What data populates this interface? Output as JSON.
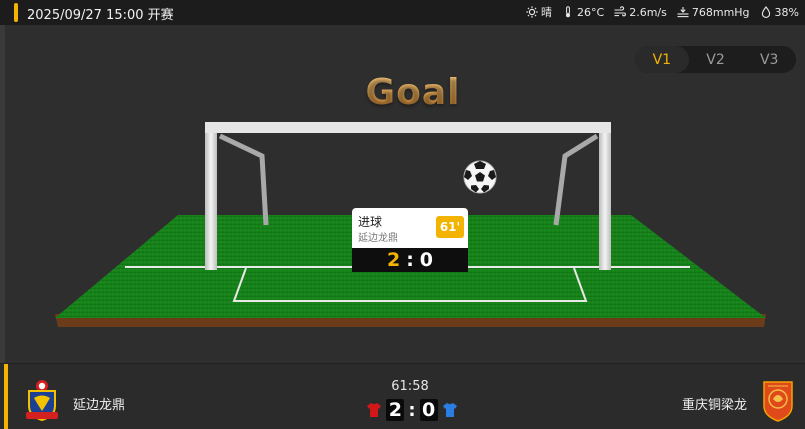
{
  "header": {
    "match_time": "2025/09/27 15:00 开赛",
    "accent_color": "#f2b400"
  },
  "weather": {
    "condition": "晴",
    "temperature": "26°C",
    "wind": "2.6m/s",
    "pressure": "768mmHg",
    "humidity": "38%",
    "icons": [
      "sun-icon",
      "thermometer-icon",
      "wind-icon",
      "pressure-icon",
      "humidity-icon"
    ]
  },
  "version_switch": {
    "options": [
      "V1",
      "V2",
      "V3"
    ],
    "active": "V1",
    "active_color": "#f2b400"
  },
  "scene": {
    "title": "Goal"
  },
  "event_popup": {
    "event": "进球",
    "team": "延边龙鼎",
    "minute": "61'",
    "score_home": "2",
    "score_sep": ":",
    "score_away": "0"
  },
  "match": {
    "home_team": "延边龙鼎",
    "away_team": "重庆铜梁龙",
    "clock": "61:58",
    "home_score": "2",
    "separator": ":",
    "away_score": "0",
    "home_kit_color": "#d01818",
    "away_kit_color": "#2a7de1"
  }
}
